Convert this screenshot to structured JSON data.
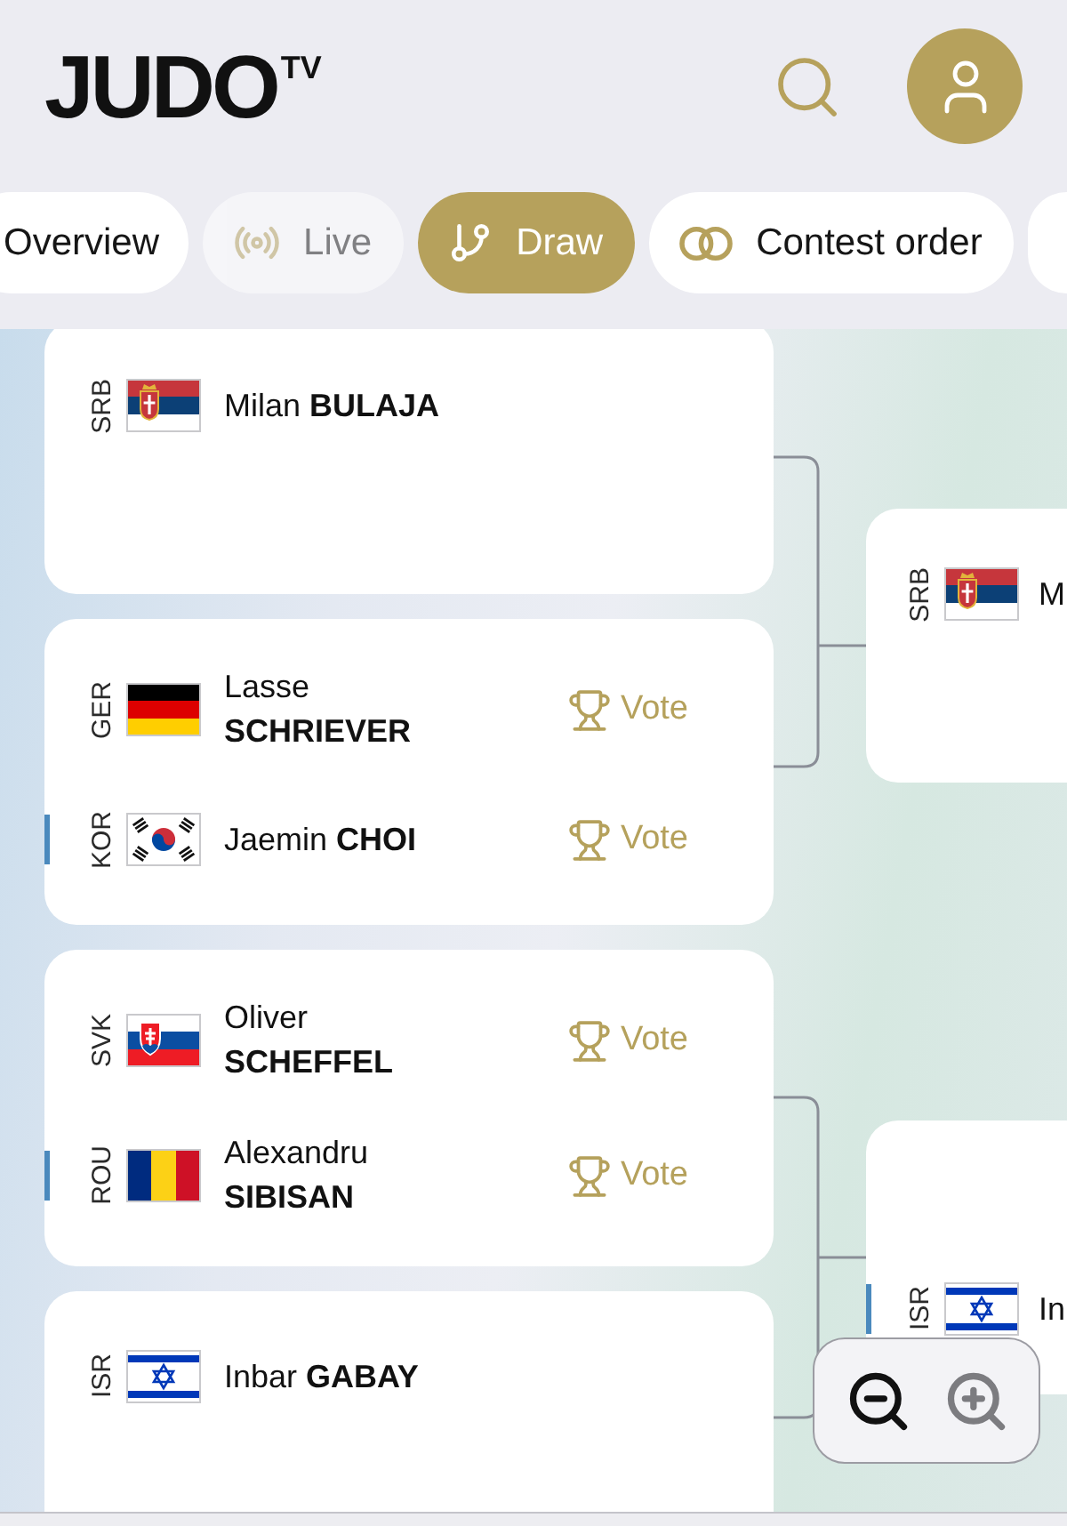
{
  "header": {
    "logo": "JUDO$^{TV}$"
  },
  "tabs": [
    {
      "label": "Overview",
      "selected": false,
      "disabled": false
    },
    {
      "label": "Live",
      "selected": false,
      "disabled": true
    },
    {
      "label": "Draw",
      "selected": true,
      "disabled": false
    },
    {
      "label": "Contest order",
      "selected": false,
      "disabled": false
    },
    {
      "selected": false
    }
  ],
  "draw": {
    "rounds": [
      {
        "matches": [
          {
            "slots": [
              {
                "kind": "athlete",
                "country": "SRB",
                "flag": {
                  "kind": "serbia"
                },
                "first_name": "Milan",
                "last_name": "BULAJA",
                "marker": false
              },
              {
                "kind": "empty"
              }
            ]
          },
          {
            "slots": [
              {
                "kind": "athlete",
                "country": "GER",
                "flag": {
                  "kind": "germany"
                },
                "first_name": "Lasse",
                "last_name": "SCHRIEVER",
                "marker": false,
                "vote": "Vote"
              },
              {
                "kind": "athlete",
                "country": "KOR",
                "flag": {
                  "kind": "south-korea"
                },
                "first_name": "Jaemin",
                "last_name": "CHOI",
                "marker": true,
                "vote": "Vote"
              }
            ]
          },
          {
            "slots": [
              {
                "kind": "athlete",
                "country": "SVK",
                "flag": {
                  "kind": "slovakia"
                },
                "first_name": "Oliver",
                "last_name": "SCHEFFEL",
                "marker": false,
                "vote": "Vote"
              },
              {
                "kind": "athlete",
                "country": "ROU",
                "flag": {
                  "kind": "romania"
                },
                "first_name": "Alexandru",
                "last_name": "SIBISAN",
                "marker": true,
                "vote": "Vote"
              }
            ]
          },
          {
            "slots": [
              {
                "kind": "athlete",
                "country": "ISR",
                "flag": {
                  "kind": "israel"
                },
                "first_name": "Inbar",
                "last_name": "GABAY",
                "marker": false
              },
              {
                "kind": "empty"
              }
            ]
          }
        ]
      },
      {
        "matches": [
          {
            "slots": [
              {
                "kind": "athlete",
                "country": "SRB",
                "flag": {
                  "kind": "serbia"
                },
                "first_name": "M",
                "marker": false
              },
              {
                "kind": "empty"
              }
            ]
          },
          {
            "slots": [
              {
                "kind": "empty"
              },
              {
                "kind": "athlete",
                "country": "ISR",
                "flag": {
                  "kind": "israel"
                },
                "first_name": "In",
                "marker": true
              }
            ]
          }
        ]
      }
    ]
  },
  "zoom_controls": [
    {
      "kind": "zoom_out",
      "disabled": false
    },
    {
      "kind": "zoom_in",
      "disabled": true
    }
  ]
}
